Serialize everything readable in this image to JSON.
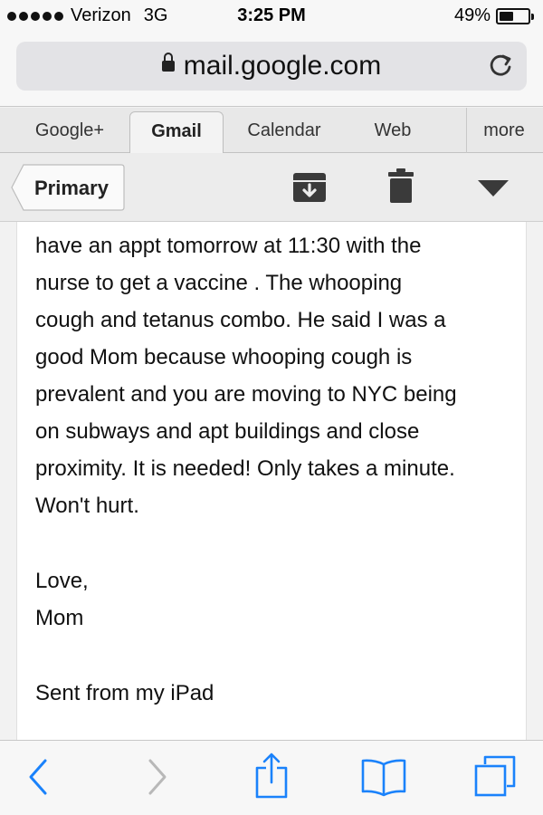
{
  "status_bar": {
    "carrier": "Verizon",
    "network": "3G",
    "time": "3:25 PM",
    "battery": "49%",
    "battery_level": 0.49,
    "signal_bars": 5
  },
  "address_bar": {
    "url": "mail.google.com",
    "lock_icon": "lock-icon",
    "reload_icon": "reload-icon"
  },
  "tabs": [
    {
      "label": "Google+",
      "active": false
    },
    {
      "label": "Gmail",
      "active": true
    },
    {
      "label": "Calendar",
      "active": false
    },
    {
      "label": "Web",
      "active": false
    },
    {
      "label": "more",
      "active": false
    }
  ],
  "toolbar": {
    "back_label": "Primary",
    "icons": [
      "archive-icon",
      "trash-icon",
      "more-actions-icon"
    ]
  },
  "message": {
    "lines": [
      "have an appt tomorrow at 11:30 with the",
      "nurse to get a vaccine . The whooping",
      "cough and tetanus combo. He said I was a",
      "good Mom because whooping cough is",
      "prevalent and you are moving to NYC being",
      "on subways and apt buildings and close",
      "proximity. It is needed! Only takes a minute.",
      "Won't hurt."
    ],
    "closing": [
      "Love,",
      "Mom"
    ],
    "signature": "Sent from my iPad"
  },
  "bottom_bar": {
    "icons": [
      "back-icon",
      "forward-icon",
      "share-icon",
      "bookmarks-icon",
      "tabs-icon"
    ]
  },
  "colors": {
    "ios_blue": "#1a82fb",
    "disabled_gray": "#b8b8b8"
  }
}
